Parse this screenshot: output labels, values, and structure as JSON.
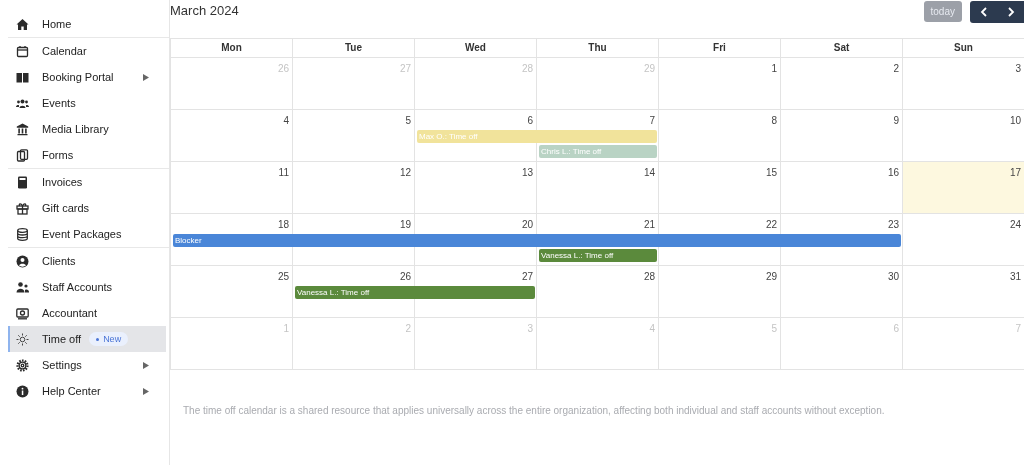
{
  "sidebar": {
    "groups": [
      [
        {
          "label": "Home",
          "selected": false
        }
      ],
      [
        {
          "label": "Calendar",
          "selected": false
        },
        {
          "label": "Booking Portal",
          "selected": false,
          "submenu": true
        },
        {
          "label": "Events",
          "selected": false
        },
        {
          "label": "Media Library",
          "selected": false
        },
        {
          "label": "Forms",
          "selected": false
        }
      ],
      [
        {
          "label": "Invoices",
          "selected": false
        },
        {
          "label": "Gift cards",
          "selected": false
        },
        {
          "label": "Event Packages",
          "selected": false
        }
      ],
      [
        {
          "label": "Clients",
          "selected": false
        },
        {
          "label": "Staff Accounts",
          "selected": false
        },
        {
          "label": "Accountant",
          "selected": false
        },
        {
          "label": "Time off",
          "selected": true,
          "badge": "New"
        },
        {
          "label": "Settings",
          "selected": false,
          "submenu": true
        },
        {
          "label": "Help Center",
          "selected": false,
          "submenu": true
        }
      ]
    ]
  },
  "calendar": {
    "title": "March 2024",
    "today_button": {
      "label": "today",
      "disabled": true
    },
    "columns": [
      "Mon",
      "Tue",
      "Wed",
      "Thu",
      "Fri",
      "Sat",
      "Sun"
    ],
    "weeks": [
      {
        "days": [
          {
            "label": "26",
            "muted": true
          },
          {
            "label": "27",
            "muted": true
          },
          {
            "label": "28",
            "muted": true
          },
          {
            "label": "29",
            "muted": true
          },
          {
            "label": "1",
            "muted": false
          },
          {
            "label": "2",
            "muted": false
          },
          {
            "label": "3",
            "muted": false
          }
        ]
      },
      {
        "days": [
          {
            "label": "4",
            "muted": false
          },
          {
            "label": "5",
            "muted": false
          },
          {
            "label": "6",
            "muted": false
          },
          {
            "label": "7",
            "muted": false
          },
          {
            "label": "8",
            "muted": false
          },
          {
            "label": "9",
            "muted": false
          },
          {
            "label": "10",
            "muted": false
          }
        ],
        "events": [
          {
            "title": "Max O.: Time off",
            "color": "#f1e39b"
          },
          {
            "title": "Chris L.: Time off",
            "color": "#b9d3c4"
          }
        ]
      },
      {
        "days": [
          {
            "label": "11",
            "muted": false
          },
          {
            "label": "12",
            "muted": false
          },
          {
            "label": "13",
            "muted": false
          },
          {
            "label": "14",
            "muted": false
          },
          {
            "label": "15",
            "muted": false
          },
          {
            "label": "16",
            "muted": false
          },
          {
            "label": "17",
            "muted": false,
            "today": true
          }
        ]
      },
      {
        "days": [
          {
            "label": "18",
            "muted": false
          },
          {
            "label": "19",
            "muted": false
          },
          {
            "label": "20",
            "muted": false
          },
          {
            "label": "21",
            "muted": false
          },
          {
            "label": "22",
            "muted": false
          },
          {
            "label": "23",
            "muted": false
          },
          {
            "label": "24",
            "muted": false
          }
        ],
        "events": [
          {
            "title": "Blocker",
            "color": "#4a86d8"
          },
          {
            "title": "Vanessa L.: Time off",
            "color": "#5b8a3c"
          }
        ]
      },
      {
        "days": [
          {
            "label": "25",
            "muted": false
          },
          {
            "label": "26",
            "muted": false
          },
          {
            "label": "27",
            "muted": false
          },
          {
            "label": "28",
            "muted": false
          },
          {
            "label": "29",
            "muted": false
          },
          {
            "label": "30",
            "muted": false
          },
          {
            "label": "31",
            "muted": false
          }
        ],
        "events": [
          {
            "title": "Vanessa L.: Time off",
            "color": "#5b8a3c"
          }
        ]
      },
      {
        "days": [
          {
            "label": "1",
            "muted": true
          },
          {
            "label": "2",
            "muted": true
          },
          {
            "label": "3",
            "muted": true
          },
          {
            "label": "4",
            "muted": true
          },
          {
            "label": "5",
            "muted": true
          },
          {
            "label": "6",
            "muted": true
          },
          {
            "label": "7",
            "muted": true
          }
        ]
      }
    ]
  },
  "footer_note": "The time off calendar is a shared resource that applies universally across the entire organization, affecting both individual and staff accounts without exception."
}
